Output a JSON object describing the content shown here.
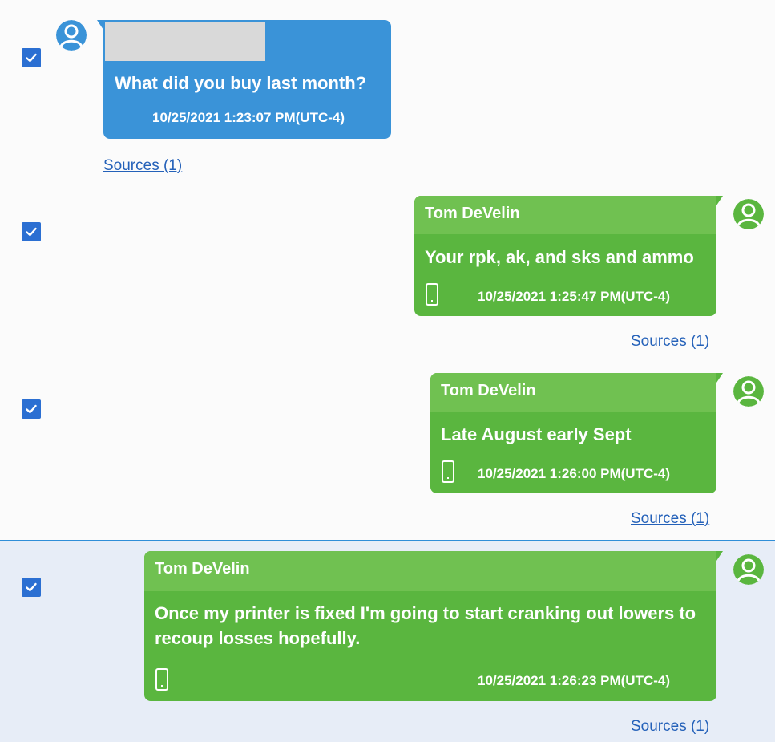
{
  "messages": [
    {
      "direction": "outgoing",
      "selected": false,
      "sender": "",
      "text": "What did you buy last month?",
      "timestamp": "10/25/2021 1:23:07 PM(UTC-4)",
      "sources_label": "Sources (1)",
      "checked": true,
      "has_device_icon": false,
      "sender_redacted": true
    },
    {
      "direction": "incoming",
      "selected": false,
      "sender": "Tom DeVelin",
      "text": "Your rpk, ak, and sks and ammo",
      "timestamp": "10/25/2021 1:25:47 PM(UTC-4)",
      "sources_label": "Sources (1)",
      "checked": true,
      "has_device_icon": true
    },
    {
      "direction": "incoming",
      "selected": false,
      "sender": "Tom DeVelin",
      "text": "Late August early Sept",
      "timestamp": "10/25/2021 1:26:00 PM(UTC-4)",
      "sources_label": "Sources (1)",
      "checked": true,
      "has_device_icon": true
    },
    {
      "direction": "incoming",
      "selected": true,
      "sender": "Tom DeVelin",
      "text": "Once my printer is fixed I'm going to start cranking out lowers to recoup losses hopefully.",
      "timestamp": "10/25/2021 1:26:23 PM(UTC-4)",
      "sources_label": "Sources (1)",
      "checked": true,
      "has_device_icon": true
    }
  ],
  "colors": {
    "outgoing_bubble": "#3a93d8",
    "incoming_bubble": "#5ab63f",
    "incoming_header": "#70c151",
    "checkbox": "#2b6fd2",
    "link": "#2461b9",
    "selected_row": "#e7edf7",
    "selected_border": "#2f8ed8"
  },
  "icons": {
    "checkbox": "checkmark-icon",
    "avatar": "user-avatar-icon",
    "device": "phone-icon"
  }
}
